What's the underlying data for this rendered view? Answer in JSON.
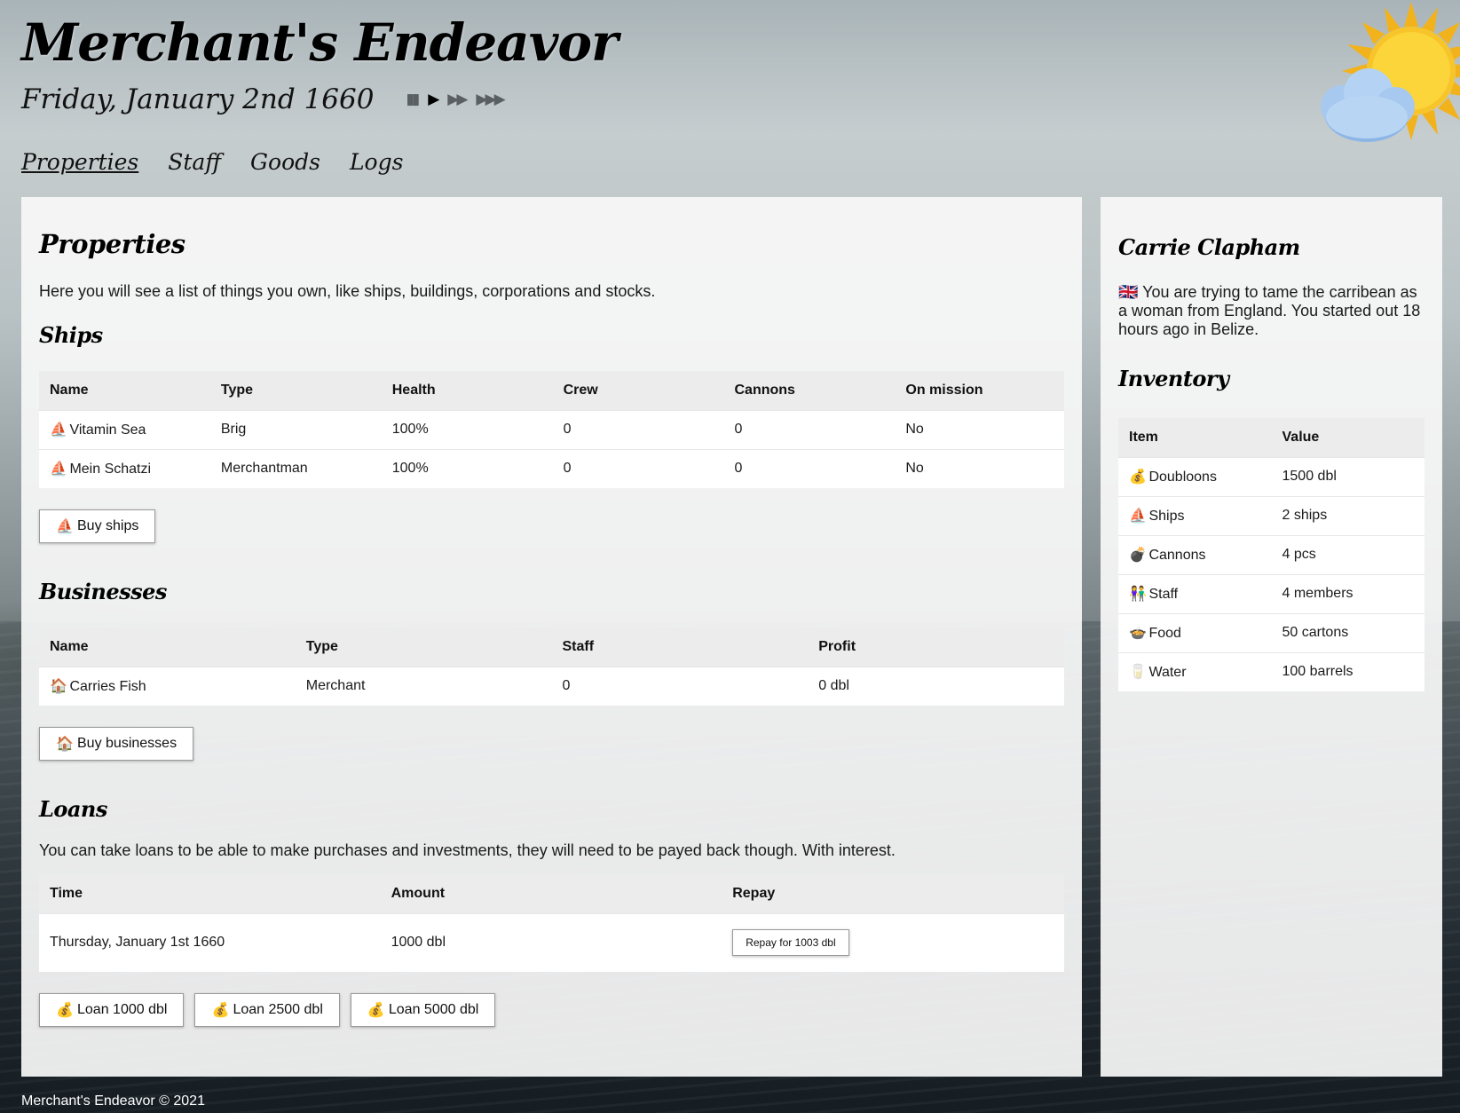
{
  "app": {
    "title": "Merchant's Endeavor",
    "date": "Friday, January 2nd 1660",
    "footer": "Merchant's Endeavor © 2021"
  },
  "speed_controls": [
    {
      "name": "pause",
      "glyph": "▮▮"
    },
    {
      "name": "play",
      "glyph": "▶"
    },
    {
      "name": "fast",
      "glyph": "▶▶"
    },
    {
      "name": "fastest",
      "glyph": "▶▶▶"
    }
  ],
  "nav": [
    {
      "label": "Properties",
      "active": true
    },
    {
      "label": "Staff"
    },
    {
      "label": "Goods"
    },
    {
      "label": "Logs"
    }
  ],
  "main": {
    "heading": "Properties",
    "intro": "Here you will see a list of things you own, like ships, buildings, corporations and stocks.",
    "ships": {
      "heading": "Ships",
      "columns": [
        "Name",
        "Type",
        "Health",
        "Crew",
        "Cannons",
        "On mission"
      ],
      "rows": [
        {
          "icon": "⛵",
          "name": "Vitamin Sea",
          "type": "Brig",
          "health": "100%",
          "crew": "0",
          "cannons": "0",
          "mission": "No"
        },
        {
          "icon": "⛵",
          "name": "Mein Schatzi",
          "type": "Merchantman",
          "health": "100%",
          "crew": "0",
          "cannons": "0",
          "mission": "No"
        }
      ],
      "button": {
        "icon": "⛵",
        "label": "Buy ships"
      }
    },
    "businesses": {
      "heading": "Businesses",
      "columns": [
        "Name",
        "Type",
        "Staff",
        "Profit"
      ],
      "rows": [
        {
          "icon": "🏠",
          "name": "Carries Fish",
          "type": "Merchant",
          "staff": "0",
          "profit": "0 dbl"
        }
      ],
      "button": {
        "icon": "🏠",
        "label": "Buy businesses"
      }
    },
    "loans": {
      "heading": "Loans",
      "intro": "You can take loans to be able to make purchases and investments, they will need to be payed back though. With interest.",
      "columns": [
        "Time",
        "Amount",
        "Repay"
      ],
      "rows": [
        {
          "time": "Thursday, January 1st 1660",
          "amount": "1000 dbl",
          "repay": "Repay for 1003 dbl"
        }
      ],
      "buttons": [
        {
          "icon": "💰",
          "label": "Loan 1000 dbl"
        },
        {
          "icon": "💰",
          "label": "Loan 2500 dbl"
        },
        {
          "icon": "💰",
          "label": "Loan 5000 dbl"
        }
      ]
    }
  },
  "side": {
    "player_name": "Carrie Clapham",
    "flag_icon": "🇬🇧",
    "bio": "You are trying to tame the carribean as a woman from England. You started out 18 hours ago in Belize.",
    "inventory": {
      "heading": "Inventory",
      "columns": [
        "Item",
        "Value"
      ],
      "rows": [
        {
          "icon": "💰",
          "item": "Doubloons",
          "value": "1500 dbl"
        },
        {
          "icon": "⛵",
          "item": "Ships",
          "value": "2 ships"
        },
        {
          "icon": "💣",
          "item": "Cannons",
          "value": "4 pcs"
        },
        {
          "icon": "👫",
          "item": "Staff",
          "value": "4 members"
        },
        {
          "icon": "🍲",
          "item": "Food",
          "value": "50 cartons"
        },
        {
          "icon": "🥛",
          "item": "Water",
          "value": "100 barrels"
        }
      ]
    }
  }
}
